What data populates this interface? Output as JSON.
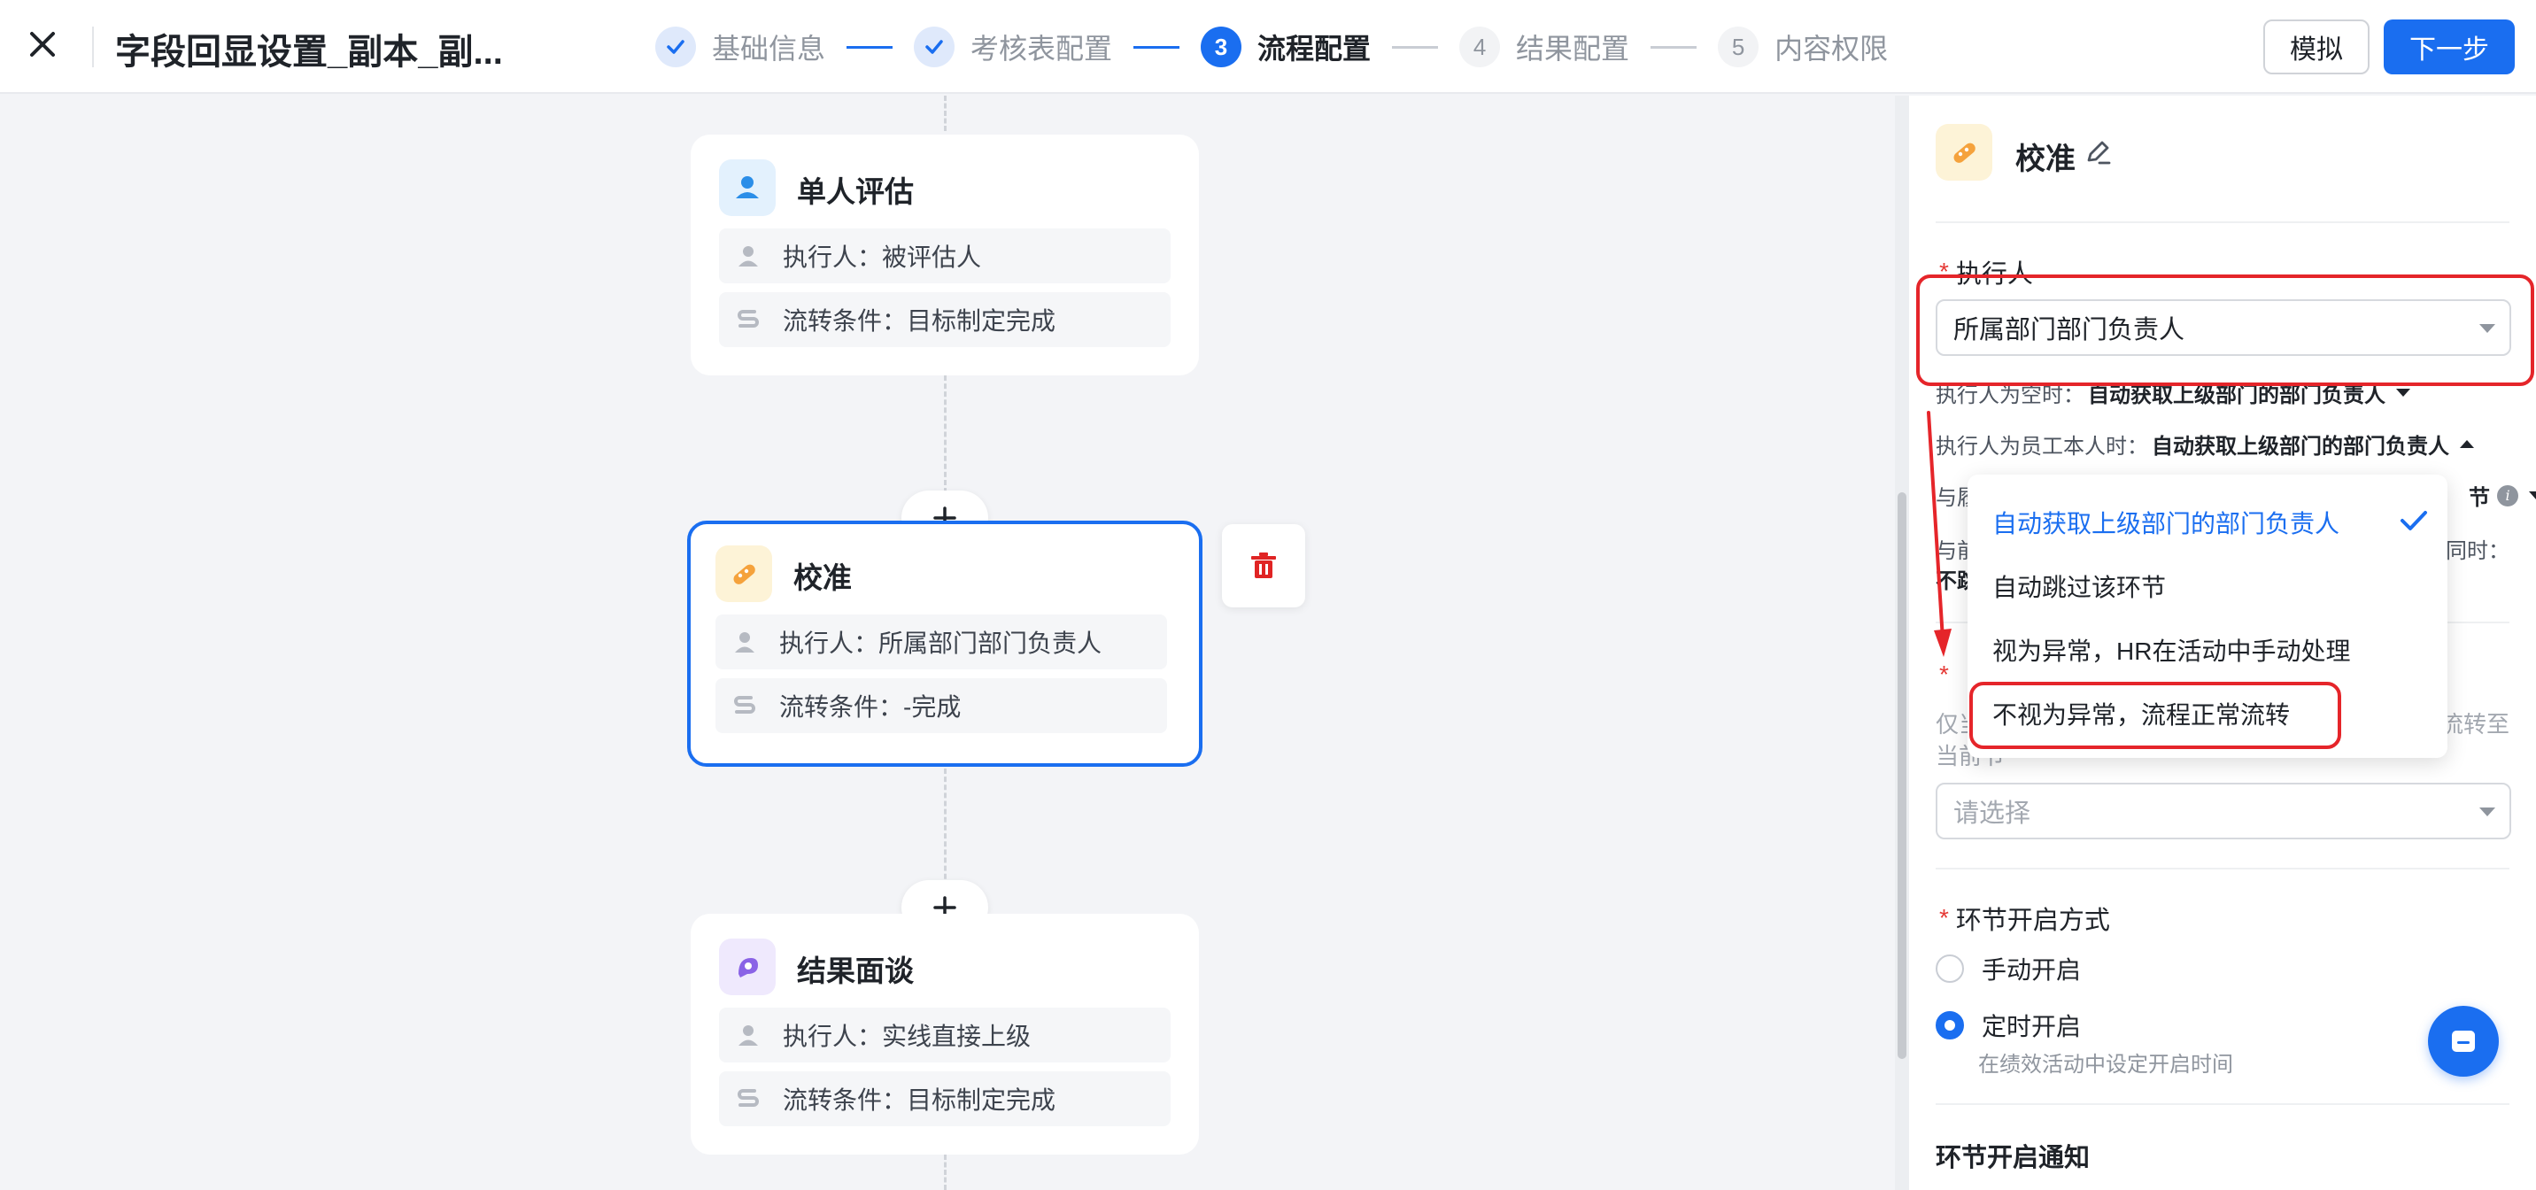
{
  "header": {
    "title": "字段回显设置_副本_副...",
    "steps": [
      {
        "num": "✓",
        "label": "基础信息"
      },
      {
        "num": "✓",
        "label": "考核表配置"
      },
      {
        "num": "3",
        "label": "流程配置"
      },
      {
        "num": "4",
        "label": "结果配置"
      },
      {
        "num": "5",
        "label": "内容权限"
      }
    ],
    "simulate_label": "模拟",
    "next_label": "下一步"
  },
  "flow": {
    "nodes": [
      {
        "title": "单人评估",
        "executor_label": "执行人：",
        "executor": "被评估人",
        "condition_label": "流转条件：",
        "condition": "目标制定完成"
      },
      {
        "title": "校准",
        "executor_label": "执行人：",
        "executor": "所属部门部门负责人",
        "condition_label": "流转条件：",
        "condition": "-完成"
      },
      {
        "title": "结果面谈",
        "executor_label": "执行人：",
        "executor": "实线直接上级",
        "condition_label": "流转条件：",
        "condition": "目标制定完成"
      }
    ],
    "add_symbol": "+"
  },
  "panel": {
    "title": "校准",
    "executor": {
      "required": "*",
      "label": "执行人",
      "value": "所属部门部门负责人"
    },
    "when_empty": {
      "label": "执行人为空时：",
      "value": "自动获取上级部门的部门负责人"
    },
    "when_self": {
      "label": "执行人为员工本人时：",
      "value": "自动获取上级部门的部门负责人"
    },
    "row3_start": "与履",
    "row3_end": "节",
    "row4_start": "与前",
    "row4_end": "同时：",
    "row5_start": "不跳",
    "section2": {
      "required": "*",
      "desc_start": "仅当",
      "desc_end": "流转至",
      "desc_line2": "当前节",
      "placeholder": "请选择"
    },
    "open_mode": {
      "required": "*",
      "label": "环节开启方式",
      "options": [
        {
          "label": "手动开启",
          "checked": false
        },
        {
          "label": "定时开启",
          "checked": true,
          "sub": "在绩效活动中设定开启时间"
        }
      ]
    },
    "notify_title": "环节开启通知"
  },
  "dropdown": {
    "options": [
      {
        "label": "自动获取上级部门的部门负责人",
        "selected": true
      },
      {
        "label": "自动跳过该环节",
        "selected": false
      },
      {
        "label": "视为异常，HR在活动中手动处理",
        "selected": false
      },
      {
        "label": "不视为异常，流程正常流转",
        "selected": false
      }
    ]
  },
  "colors": {
    "primary": "#1a6ef0",
    "annotation": "#e5252a",
    "delete": "#e02424"
  }
}
